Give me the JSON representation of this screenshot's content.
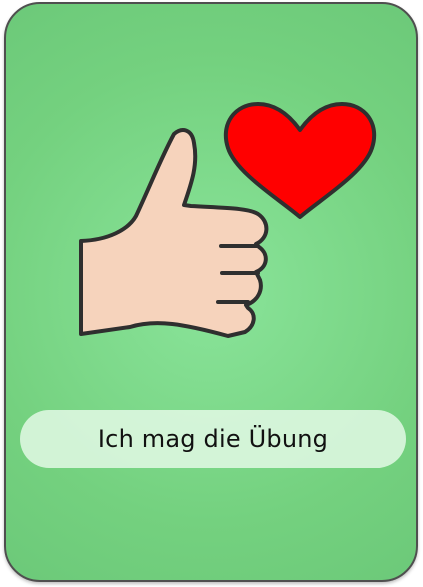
{
  "card": {
    "label": "Ich mag die Übung",
    "icons": [
      "thumbs-up-icon",
      "heart-icon"
    ]
  },
  "colors": {
    "card_background": "#76d383",
    "border": "#4f4f4f",
    "heart": "#ff0000",
    "skin": "#f6d3bc",
    "outline": "#2f2f2f",
    "label_background": "#e6fae9"
  }
}
